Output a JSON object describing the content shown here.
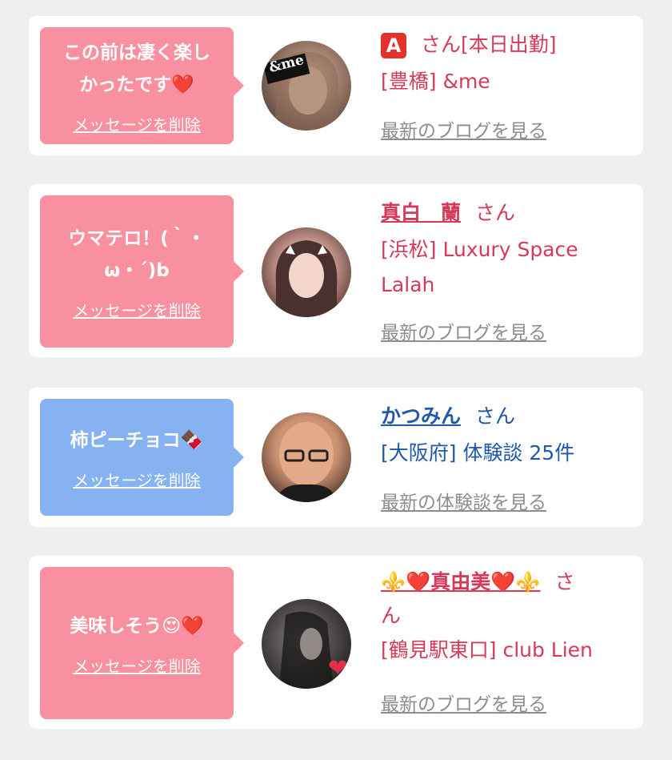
{
  "cards": [
    {
      "message": "この前は凄く楽しかったです❤️",
      "message_lines": [
        "この前は凄く楽し",
        "かったです❤️"
      ],
      "delete_label": "メッセージを削除",
      "name": "🅰️",
      "san": "さん[本日出勤]",
      "shop": "[豊橋] &me",
      "link": "最新のブログを見る",
      "bubble_color": "#f9909f",
      "text_color": "#d63a58"
    },
    {
      "message_lines": [
        "ウマテロ！(｀・",
        "ω・´)b"
      ],
      "delete_label": "メッセージを削除",
      "name": "真白　蘭",
      "san": "さん",
      "shop_lines": [
        "[浜松] Luxury Space",
        "Lalah"
      ],
      "link": "最新のブログを見る",
      "bubble_color": "#f9909f",
      "text_color": "#d63a58"
    },
    {
      "message_lines": [
        "柿ピーチョコ🍫"
      ],
      "delete_label": "メッセージを削除",
      "name": "かつみん",
      "san": "さん",
      "shop": "[大阪府] 体験談 25件",
      "link": "最新の体験談を見る",
      "bubble_color": "#86b2f2",
      "text_color": "#1f59a8"
    },
    {
      "message_lines": [
        "美味しそう😍❤️"
      ],
      "delete_label": "メッセージを削除",
      "name": "⚜️❤️真由美❤️⚜️",
      "san_lines": [
        "さ",
        "ん"
      ],
      "shop": "[鶴見駅東口] club Lien",
      "link": "最新のブログを見る",
      "bubble_color": "#f9909f",
      "text_color": "#d63a58"
    }
  ],
  "avatar_badge": "&me"
}
